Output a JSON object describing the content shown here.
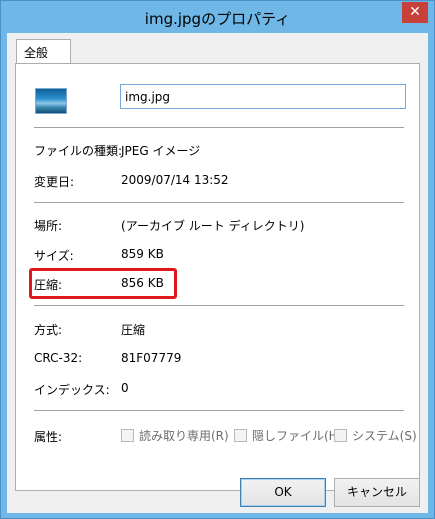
{
  "window": {
    "title": "img.jpgのプロパティ",
    "close_label": "✕"
  },
  "tabs": [
    {
      "label": "全般"
    }
  ],
  "file": {
    "name": "img.jpg"
  },
  "props": {
    "type_label": "ファイルの種類:",
    "type_value": "JPEG イメージ",
    "modified_label": "変更日:",
    "modified_value": "2009/07/14 13:52",
    "location_label": "場所:",
    "location_value": "(アーカイブ ルート ディレクトリ)",
    "size_label": "サイズ:",
    "size_value": "859 KB",
    "compressed_label": "圧縮:",
    "compressed_value": "856 KB",
    "method_label": "方式:",
    "method_value": "圧縮",
    "crc_label": "CRC-32:",
    "crc_value": "81F07779",
    "index_label": "インデックス:",
    "index_value": "0",
    "attrs_label": "属性:"
  },
  "attributes": {
    "readonly": "読み取り専用(R)",
    "hidden": "隠しファイル(H)",
    "system": "システム(S)"
  },
  "buttons": {
    "ok": "OK",
    "cancel": "キャンセル"
  },
  "colors": {
    "titlebar": "#6fb7e6",
    "close": "#c7403a",
    "highlight": "#e0181a"
  }
}
